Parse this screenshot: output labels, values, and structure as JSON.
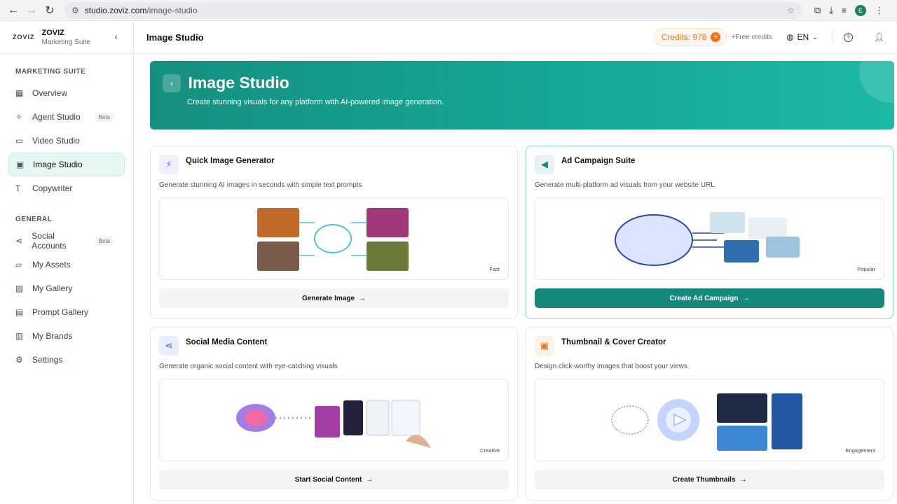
{
  "browser": {
    "url_host": "studio.zoviz.com",
    "url_path": "/image-studio",
    "profile_initial": "E"
  },
  "brand": {
    "logo": "ZOVIZ",
    "name": "ZOVIZ",
    "sub": "Marketing Suite"
  },
  "sidebar": {
    "section1": "MARKETING SUITE",
    "section2": "GENERAL",
    "marketing_items": [
      {
        "label": "Overview",
        "icon": "grid-icon"
      },
      {
        "label": "Agent Studio",
        "icon": "sparkle-icon",
        "badge": "Beta"
      },
      {
        "label": "Video Studio",
        "icon": "video-icon"
      },
      {
        "label": "Image Studio",
        "icon": "image-icon",
        "active": true
      },
      {
        "label": "Copywriter",
        "icon": "type-icon"
      }
    ],
    "general_items": [
      {
        "label": "Social Accounts",
        "icon": "share-icon",
        "badge": "Beta"
      },
      {
        "label": "My Assets",
        "icon": "folder-icon"
      },
      {
        "label": "My Gallery",
        "icon": "gallery-icon"
      },
      {
        "label": "Prompt Gallery",
        "icon": "document-icon"
      },
      {
        "label": "My Brands",
        "icon": "brand-icon"
      },
      {
        "label": "Settings",
        "icon": "gear-icon"
      }
    ]
  },
  "topbar": {
    "title": "Image Studio",
    "credits_label": "Credits: 978",
    "free_credits": "+Free credits",
    "language": "EN"
  },
  "hero": {
    "title": "Image Studio",
    "subtitle": "Create stunning visuals for any platform with AI-powered image generation."
  },
  "cards": [
    {
      "title": "Quick Image Generator",
      "desc": "Generate stunning AI images in seconds with simple text prompts",
      "tag": "Fast",
      "cta": "Generate Image",
      "icon": "lightning-icon",
      "accent": "#8b5cf6"
    },
    {
      "title": "Ad Campaign Suite",
      "desc": "Generate multi-platform ad visuals from your website URL",
      "tag": "Popular",
      "cta": "Create Ad Campaign",
      "icon": "megaphone-icon",
      "accent": "#14897c"
    },
    {
      "title": "Social Media Content",
      "desc": "Generate organic social content with eye-catching visuals",
      "tag": "Creative",
      "cta": "Start Social Content",
      "icon": "share-icon",
      "accent": "#2563eb"
    },
    {
      "title": "Thumbnail & Cover Creator",
      "desc": "Design click-worthy images that boost your views",
      "tag": "Engagement",
      "cta": "Create Thumbnails",
      "icon": "image-icon",
      "accent": "#f97316"
    }
  ]
}
